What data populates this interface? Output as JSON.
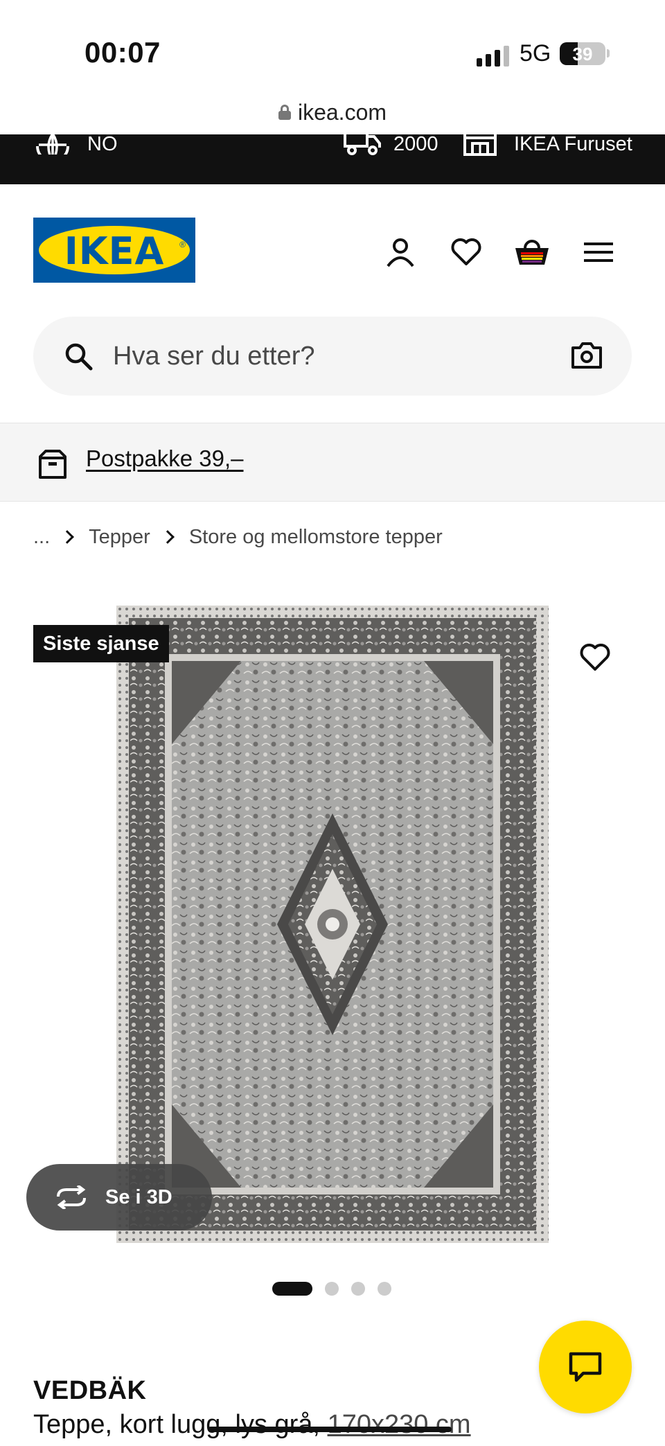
{
  "status_bar": {
    "time": "00:07",
    "network": "5G",
    "battery": "39",
    "battery_level": 0.39
  },
  "browser": {
    "url": "ikea.com"
  },
  "top_strip": {
    "language": "NO",
    "postcode": "2000",
    "store": "IKEA Furuset",
    "icons": [
      "globe-icon",
      "truck-icon",
      "store-icon"
    ]
  },
  "header": {
    "logo_text": "IKEA",
    "icons": [
      "account-icon",
      "heart-icon",
      "basket-icon",
      "menu-icon"
    ],
    "colors": {
      "logo_blue": "#0058a3",
      "logo_yellow": "#ffdb00"
    }
  },
  "search": {
    "placeholder": "Hva ser du etter?",
    "icons": [
      "search-icon",
      "camera-icon"
    ]
  },
  "promo": {
    "text": "Postpakke 39,–",
    "icon": "parcel-icon"
  },
  "breadcrumb": {
    "items": [
      "...",
      "Tepper",
      "Store og mellomstore tepper"
    ]
  },
  "gallery": {
    "badge": "Siste sjanse",
    "view_3d_label": "Se i 3D",
    "page_count": 4,
    "active_page": 1
  },
  "product": {
    "name": "VEDBÄK",
    "description": "Teppe, kort lugg, lys grå,",
    "size": "170x230 cm"
  },
  "chat": {
    "icon": "chat-icon",
    "color": "#ffdb00"
  }
}
